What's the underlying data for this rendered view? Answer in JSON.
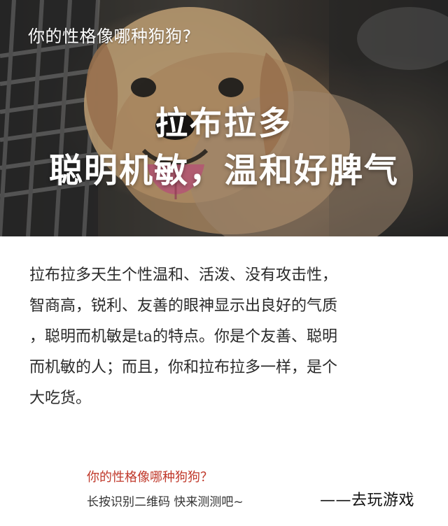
{
  "hero": {
    "question": "你的性格像哪种狗狗?",
    "breed": "拉布拉多",
    "traits": "聪明机敏，温和好脾气"
  },
  "description": {
    "lines": [
      "拉布拉多天生个性温和、活泼、没有攻击性，",
      "智商高，锐利、友善的眼神显示出良好的气质",
      "，聪明而机敏是ta的特点。你是个友善、聪明",
      "而机敏的人；而且，你和拉布拉多一样，是个",
      "大吃货。"
    ]
  },
  "footer": {
    "question": "你的性格像哪种狗狗？",
    "scan_hint": "长按识别二维码  快来测测吧~",
    "cta": "——去玩游戏"
  },
  "colors": {
    "footer_question": "#c0392b",
    "text": "#2a2a2a"
  },
  "icons": {
    "hero_image": "labrador-dog-photo"
  }
}
